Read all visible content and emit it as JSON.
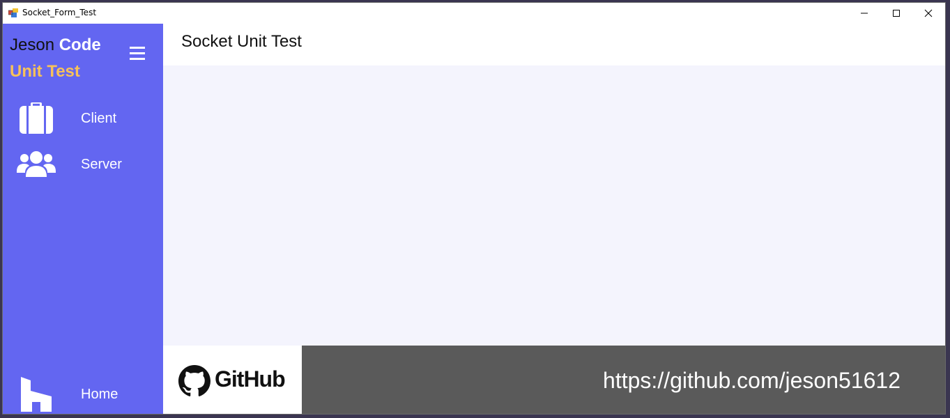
{
  "window": {
    "title": "Socket_Form_Test"
  },
  "sidebar": {
    "brand_line1_a": "Jeson",
    "brand_line1_b": "Code",
    "brand_line2": "Unit Test",
    "menu_icon": "hamburger-icon",
    "items": [
      {
        "label": "Client",
        "icon": "briefcase-icon"
      },
      {
        "label": "Server",
        "icon": "users-icon"
      },
      {
        "label": "Home",
        "icon": "house-icon"
      }
    ]
  },
  "header": {
    "title": "Socket Unit Test"
  },
  "footer": {
    "github_word": "GitHub",
    "url": "https://github.com/jeson51612"
  },
  "colors": {
    "sidebar_bg": "#6366f1",
    "brand_accent": "#f6c15b",
    "content_bg": "#f4f4fd",
    "footer_bg": "#5a5a5a"
  }
}
